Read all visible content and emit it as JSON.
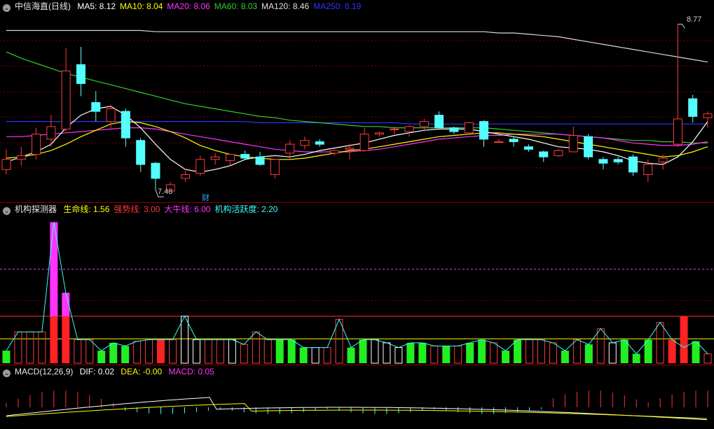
{
  "main": {
    "title": "中信海直(日线)",
    "ma": [
      {
        "label": "MA5: 8.12",
        "color": "#ffffff"
      },
      {
        "label": "MA10: 8.04",
        "color": "#ffff00"
      },
      {
        "label": "MA20: 8.06",
        "color": "#ff33ff"
      },
      {
        "label": "MA60: 8.03",
        "color": "#33cc33"
      },
      {
        "label": "MA120: 8.46",
        "color": "#e0e0e0"
      },
      {
        "label": "MA250: 8.19",
        "color": "#3333ff"
      }
    ],
    "high_label": "8.77",
    "low_label": "7.48",
    "fin_badge": "财",
    "candles": [
      [
        7.62,
        7.78,
        7.58,
        7.7
      ],
      [
        7.7,
        7.8,
        7.65,
        7.73
      ],
      [
        7.74,
        7.95,
        7.7,
        7.9
      ],
      [
        7.86,
        8.05,
        7.8,
        7.96
      ],
      [
        7.94,
        8.58,
        7.92,
        8.4
      ],
      [
        8.45,
        8.59,
        8.2,
        8.3
      ],
      [
        8.15,
        8.24,
        8.0,
        8.08
      ],
      [
        8.0,
        8.13,
        7.95,
        8.1
      ],
      [
        8.08,
        8.1,
        7.8,
        7.87
      ],
      [
        7.85,
        7.87,
        7.6,
        7.66
      ],
      [
        7.67,
        7.68,
        7.46,
        7.55
      ],
      [
        7.45,
        7.52,
        7.46,
        7.5
      ],
      [
        7.55,
        7.61,
        7.52,
        7.58
      ],
      [
        7.59,
        7.73,
        7.57,
        7.7
      ],
      [
        7.7,
        7.75,
        7.66,
        7.72
      ],
      [
        7.69,
        7.73,
        7.65,
        7.74
      ],
      [
        7.74,
        7.77,
        7.7,
        7.71
      ],
      [
        7.72,
        7.76,
        7.65,
        7.66
      ],
      [
        7.58,
        7.7,
        7.55,
        7.7
      ],
      [
        7.75,
        7.85,
        7.7,
        7.82
      ],
      [
        7.81,
        7.88,
        7.78,
        7.85
      ],
      [
        7.84,
        7.86,
        7.8,
        7.82
      ],
      [
        7.75,
        7.78,
        7.73,
        7.77
      ],
      [
        7.78,
        7.82,
        7.7,
        7.79
      ],
      [
        7.77,
        7.95,
        7.76,
        7.9
      ],
      [
        7.9,
        7.92,
        7.88,
        7.91
      ],
      [
        7.94,
        7.96,
        7.9,
        7.94
      ],
      [
        7.92,
        7.97,
        7.88,
        7.96
      ],
      [
        7.96,
        8.02,
        7.92,
        8.0
      ],
      [
        8.05,
        8.08,
        7.98,
        7.95
      ],
      [
        7.95,
        7.96,
        7.9,
        7.92
      ],
      [
        7.91,
        8.0,
        7.9,
        7.99
      ],
      [
        8.0,
        8.01,
        7.8,
        7.86
      ],
      [
        7.84,
        7.86,
        7.83,
        7.84
      ],
      [
        7.86,
        7.88,
        7.8,
        7.84
      ],
      [
        7.8,
        7.82,
        7.76,
        7.78
      ],
      [
        7.76,
        7.77,
        7.68,
        7.72
      ],
      [
        7.73,
        7.78,
        7.72,
        7.77
      ],
      [
        7.76,
        7.96,
        7.76,
        7.89
      ],
      [
        7.88,
        7.9,
        7.7,
        7.72
      ],
      [
        7.7,
        7.72,
        7.62,
        7.67
      ],
      [
        7.7,
        7.72,
        7.66,
        7.68
      ],
      [
        7.72,
        7.74,
        7.57,
        7.6
      ],
      [
        7.58,
        7.7,
        7.52,
        7.66
      ],
      [
        7.68,
        7.74,
        7.62,
        7.71
      ],
      [
        7.82,
        8.77,
        7.8,
        8.02
      ],
      [
        8.18,
        8.21,
        7.99,
        8.04
      ],
      [
        8.03,
        8.08,
        7.95,
        8.06
      ]
    ],
    "ma5": [
      7.68,
      7.72,
      7.76,
      7.82,
      7.95,
      8.05,
      8.1,
      8.12,
      8.05,
      7.95,
      7.82,
      7.7,
      7.62,
      7.6,
      7.62,
      7.65,
      7.7,
      7.72,
      7.73,
      7.72,
      7.74,
      7.77,
      7.79,
      7.81,
      7.83,
      7.86,
      7.89,
      7.91,
      7.93,
      7.94,
      7.94,
      7.94,
      7.92,
      7.9,
      7.88,
      7.86,
      7.83,
      7.8,
      7.79,
      7.78,
      7.76,
      7.73,
      7.69,
      7.67,
      7.66,
      7.72,
      7.84,
      8.0
    ],
    "ma10": [
      7.71,
      7.72,
      7.74,
      7.77,
      7.82,
      7.88,
      7.93,
      7.98,
      8.0,
      7.99,
      7.96,
      7.92,
      7.87,
      7.81,
      7.77,
      7.74,
      7.72,
      7.71,
      7.7,
      7.7,
      7.71,
      7.73,
      7.75,
      7.77,
      7.78,
      7.8,
      7.82,
      7.84,
      7.86,
      7.88,
      7.89,
      7.9,
      7.91,
      7.91,
      7.9,
      7.89,
      7.88,
      7.86,
      7.84,
      7.82,
      7.8,
      7.78,
      7.76,
      7.74,
      7.72,
      7.73,
      7.76,
      7.8
    ],
    "ma20": [
      7.88,
      7.88,
      7.89,
      7.9,
      7.91,
      7.92,
      7.93,
      7.94,
      7.95,
      7.95,
      7.94,
      7.92,
      7.9,
      7.88,
      7.86,
      7.84,
      7.82,
      7.8,
      7.78,
      7.77,
      7.76,
      7.76,
      7.76,
      7.76,
      7.77,
      7.78,
      7.8,
      7.82,
      7.84,
      7.86,
      7.87,
      7.88,
      7.89,
      7.89,
      7.9,
      7.9,
      7.9,
      7.9,
      7.89,
      7.88,
      7.87,
      7.85,
      7.83,
      7.82,
      7.81,
      7.81,
      7.82,
      7.84
    ],
    "ma60": [
      8.55,
      8.5,
      8.46,
      8.42,
      8.38,
      8.35,
      8.32,
      8.29,
      8.26,
      8.23,
      8.2,
      8.17,
      8.14,
      8.12,
      8.1,
      8.08,
      8.06,
      8.04,
      8.03,
      8.01,
      8.0,
      7.99,
      7.98,
      7.97,
      7.96,
      7.96,
      7.95,
      7.95,
      7.95,
      7.95,
      7.95,
      7.95,
      7.95,
      7.94,
      7.93,
      7.92,
      7.91,
      7.9,
      7.89,
      7.88,
      7.87,
      7.86,
      7.85,
      7.85,
      7.84,
      7.84,
      7.83,
      7.83
    ],
    "ma120": [
      8.72,
      8.72,
      8.72,
      8.72,
      8.72,
      8.72,
      8.72,
      8.72,
      8.72,
      8.72,
      8.71,
      8.71,
      8.71,
      8.71,
      8.71,
      8.71,
      8.71,
      8.71,
      8.71,
      8.71,
      8.71,
      8.71,
      8.71,
      8.71,
      8.71,
      8.71,
      8.71,
      8.71,
      8.71,
      8.71,
      8.71,
      8.71,
      8.71,
      8.7,
      8.7,
      8.69,
      8.68,
      8.67,
      8.65,
      8.63,
      8.61,
      8.59,
      8.57,
      8.55,
      8.53,
      8.51,
      8.49,
      8.47
    ],
    "ma250": [
      8.0,
      8.0,
      8.0,
      8.0,
      8.0,
      8.0,
      8.0,
      8.0,
      8.0,
      8.0,
      8.0,
      8.0,
      8.0,
      8.0,
      8.0,
      8.0,
      8.0,
      7.99,
      7.99,
      7.99,
      7.99,
      7.99,
      7.99,
      7.99,
      7.99,
      7.99,
      7.99,
      7.98,
      7.98,
      7.98,
      7.98,
      7.98,
      7.98,
      7.98,
      7.98,
      7.98,
      7.98,
      7.98,
      7.98,
      7.98,
      7.98,
      7.98,
      7.98,
      7.98,
      7.98,
      7.98,
      7.98,
      7.98
    ]
  },
  "indicator": {
    "title": "机构探测器",
    "lines": [
      {
        "label": "生命线: 1.56",
        "color": "#ffff00",
        "value": 1.56
      },
      {
        "label": "强势线: 3.00",
        "color": "#ff3333",
        "value": 3.0
      },
      {
        "label": "大牛线: 6.00",
        "color": "#ff33ff",
        "value": 6.0
      },
      {
        "label": "机构活跃度: 2.20",
        "color": "#33ffff"
      }
    ],
    "bars": [
      0.8,
      2.0,
      2.0,
      2.0,
      9.0,
      4.5,
      1.5,
      1.5,
      0.8,
      1.3,
      1.1,
      1.4,
      1.5,
      1.5,
      1.5,
      3.0,
      1.5,
      1.5,
      1.5,
      1.5,
      1.2,
      2.0,
      1.5,
      1.5,
      1.5,
      1.0,
      1.0,
      1.0,
      2.8,
      1.0,
      1.5,
      1.5,
      1.3,
      1.0,
      1.3,
      1.3,
      1.1,
      1.1,
      1.1,
      1.3,
      1.5,
      1.3,
      0.8,
      1.5,
      1.5,
      1.5,
      1.3,
      0.8,
      1.5,
      1.2,
      2.2,
      1.3,
      1.5,
      0.6,
      1.5,
      2.6,
      1.5,
      1.0,
      1.4,
      0.6,
      1.5,
      1.5,
      1.0,
      1.4,
      1.4,
      0.8,
      1.5,
      1.5,
      1.1,
      1.4,
      1.4,
      1.4,
      1.5,
      1.5,
      1.5,
      0.5,
      1.5,
      1.5,
      1.5,
      1.5,
      2.3,
      1.5,
      1.5,
      1.5,
      1.5,
      1.5,
      1.5,
      1.5,
      1.5,
      1.5,
      1.5,
      1.5,
      1.5,
      1.5,
      1.5,
      1.5,
      1.5,
      1.5,
      1.5,
      1.5,
      1.5,
      1.5,
      1.5,
      1.5,
      1.5,
      1.5,
      1.5,
      1.5,
      1.5,
      1.5,
      1.5,
      1.5,
      1.5,
      1.5,
      1.5,
      1.5,
      1.5,
      1.5,
      1.5,
      1.5,
      1.5,
      1.5
    ],
    "bar_styles": [
      "green",
      "hollow-red",
      "hollow-red",
      "hollow-red",
      "magenta",
      "magenta",
      "hollow-red",
      "hollow-red",
      "green",
      "green",
      "green",
      "hollow-red",
      "hollow-red",
      "red",
      "hollow-red",
      "hollow-white",
      "hollow-white",
      "hollow-red",
      "hollow-red",
      "hollow-white",
      "hollow-red",
      "hollow-red",
      "hollow-red",
      "green",
      "green",
      "green",
      "hollow-white",
      "hollow-red",
      "hollow-red",
      "green",
      "green",
      "hollow-white",
      "hollow-white",
      "hollow-white",
      "green",
      "green",
      "hollow-red",
      "green",
      "hollow-red",
      "green",
      "green",
      "hollow-red",
      "green",
      "green",
      "hollow-red",
      "hollow-red",
      "hollow-red",
      "green",
      "hollow-red",
      "green",
      "hollow-red",
      "hollow-white",
      "green",
      "green",
      "green",
      "hollow-red",
      "red",
      "magenta",
      "green",
      "hollow-red"
    ]
  },
  "macd": {
    "title": "MACD(12,26,9)",
    "dif": {
      "label": "DIF: 0.02",
      "color": "#ffffff"
    },
    "dea": {
      "label": "DEA: -0.00",
      "color": "#ffff00"
    },
    "macd": {
      "label": "MACD: 0.05",
      "color": "#ff33ff"
    }
  }
}
